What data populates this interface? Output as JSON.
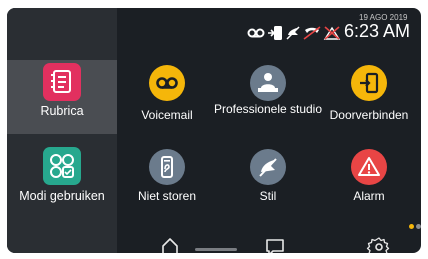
{
  "status": {
    "date": "19 AGO 2019",
    "time": "6:23 AM",
    "icons": [
      "voicemail-status-icon",
      "call-forward-status-icon",
      "mute-status-icon",
      "no-call-status-icon",
      "alarm-off-status-icon"
    ]
  },
  "sidebar": {
    "items": [
      {
        "label": "Rubrica",
        "icon": "contacts-icon",
        "color": "#e2305f"
      },
      {
        "label": "Modi gebruiken",
        "icon": "modes-icon",
        "color": "#27a88e"
      }
    ]
  },
  "apps": [
    {
      "label": "Voicemail",
      "icon": "voicemail-icon",
      "color": "#f5b60a"
    },
    {
      "label": "Professionele studio",
      "icon": "studio-icon",
      "color": "#6b7b8c"
    },
    {
      "label": "Doorverbinden",
      "icon": "call-transfer-icon",
      "color": "#f5b60a"
    },
    {
      "label": "Niet storen",
      "icon": "do-not-disturb-icon",
      "color": "#6b7b8c"
    },
    {
      "label": "Stil",
      "icon": "mute-icon",
      "color": "#6b7b8c"
    },
    {
      "label": "Alarm",
      "icon": "alarm-icon",
      "color": "#e84545"
    }
  ],
  "dock": {
    "icons": [
      "home-icon",
      "messages-icon",
      "settings-icon"
    ]
  },
  "colors": {
    "page_indicator_active": "#f5b60a",
    "page_indicator_inactive": "#8a8d92"
  }
}
